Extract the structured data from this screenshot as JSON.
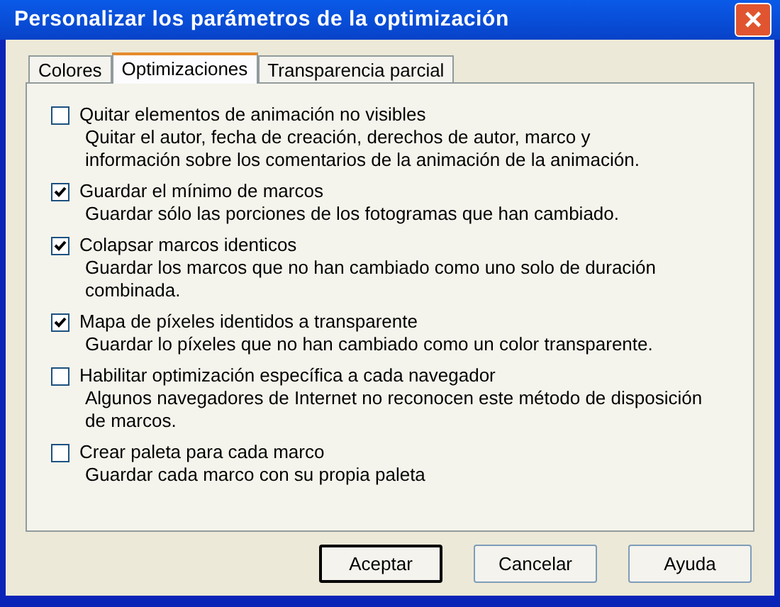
{
  "window": {
    "title": "Personalizar los parámetros de la optimización",
    "close": "×"
  },
  "tabs": [
    {
      "label": "Colores",
      "selected": false
    },
    {
      "label": "Optimizaciones",
      "selected": true
    },
    {
      "label": "Transparencia parcial",
      "selected": false
    }
  ],
  "options": [
    {
      "label": "Quitar elementos de animación no visibles",
      "checked": false,
      "description": [
        "Quitar el autor, fecha de creación, derechos de autor, marco y",
        "información sobre los comentarios de la animación de la animación."
      ]
    },
    {
      "label": "Guardar el mínimo de marcos",
      "checked": true,
      "description": [
        "Guardar sólo las porciones de los fotogramas que han cambiado."
      ]
    },
    {
      "label": "Colapsar marcos identicos",
      "checked": true,
      "description": [
        "Guardar los marcos que no han cambiado como uno solo de duración",
        "combinada."
      ]
    },
    {
      "label": "Mapa de píxeles identidos a transparente",
      "checked": true,
      "description": [
        "Guardar lo píxeles que no han cambiado como un color transparente."
      ]
    },
    {
      "label": "Habilitar optimización específica a cada navegador",
      "checked": false,
      "description": [
        "Algunos navegadores de Internet no reconocen este método de disposición",
        "de marcos."
      ]
    },
    {
      "label": "Crear paleta para cada marco",
      "checked": false,
      "description": [
        "Guardar cada marco con su propia paleta"
      ]
    }
  ],
  "buttons": [
    {
      "label": "Aceptar",
      "default": true
    },
    {
      "label": "Cancelar",
      "default": false
    },
    {
      "label": "Ayuda",
      "default": false
    }
  ]
}
